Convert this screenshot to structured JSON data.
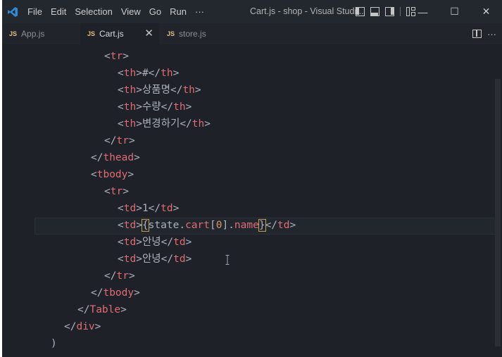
{
  "titlebar": {
    "menu": [
      "File",
      "Edit",
      "Selection",
      "View",
      "Go",
      "Run",
      "···"
    ],
    "title": "Cart.js - shop - Visual Studi...",
    "controls": {
      "minimize": "—",
      "maximize": "☐",
      "close": "✕"
    }
  },
  "tabs": [
    {
      "badge": "JS",
      "label": "App.js",
      "active": false
    },
    {
      "badge": "JS",
      "label": "Cart.js",
      "active": true,
      "close": "✕"
    },
    {
      "badge": "JS",
      "label": "store.js",
      "active": false
    }
  ],
  "editor_actions": {
    "more": "···"
  },
  "code": {
    "tr_open": "tr",
    "th": "th",
    "tr_close": "tr",
    "thead": "thead",
    "tbody": "tbody",
    "td": "td",
    "Table": "Table",
    "div": "div",
    "th_hash": "#",
    "th_product": "상품명",
    "th_qty": "수량",
    "th_change": "변경하기",
    "td_one": "1",
    "td_hello1": "안녕",
    "td_hello2": "안녕",
    "expr_open": "{",
    "expr_state": "state",
    "expr_dot1": ".",
    "expr_cart": "cart",
    "expr_bracket_open": "[",
    "expr_index": "0",
    "expr_bracket_close": "]",
    "expr_dot2": ".",
    "expr_name": "name",
    "expr_close": "}",
    "paren_close": ")"
  }
}
